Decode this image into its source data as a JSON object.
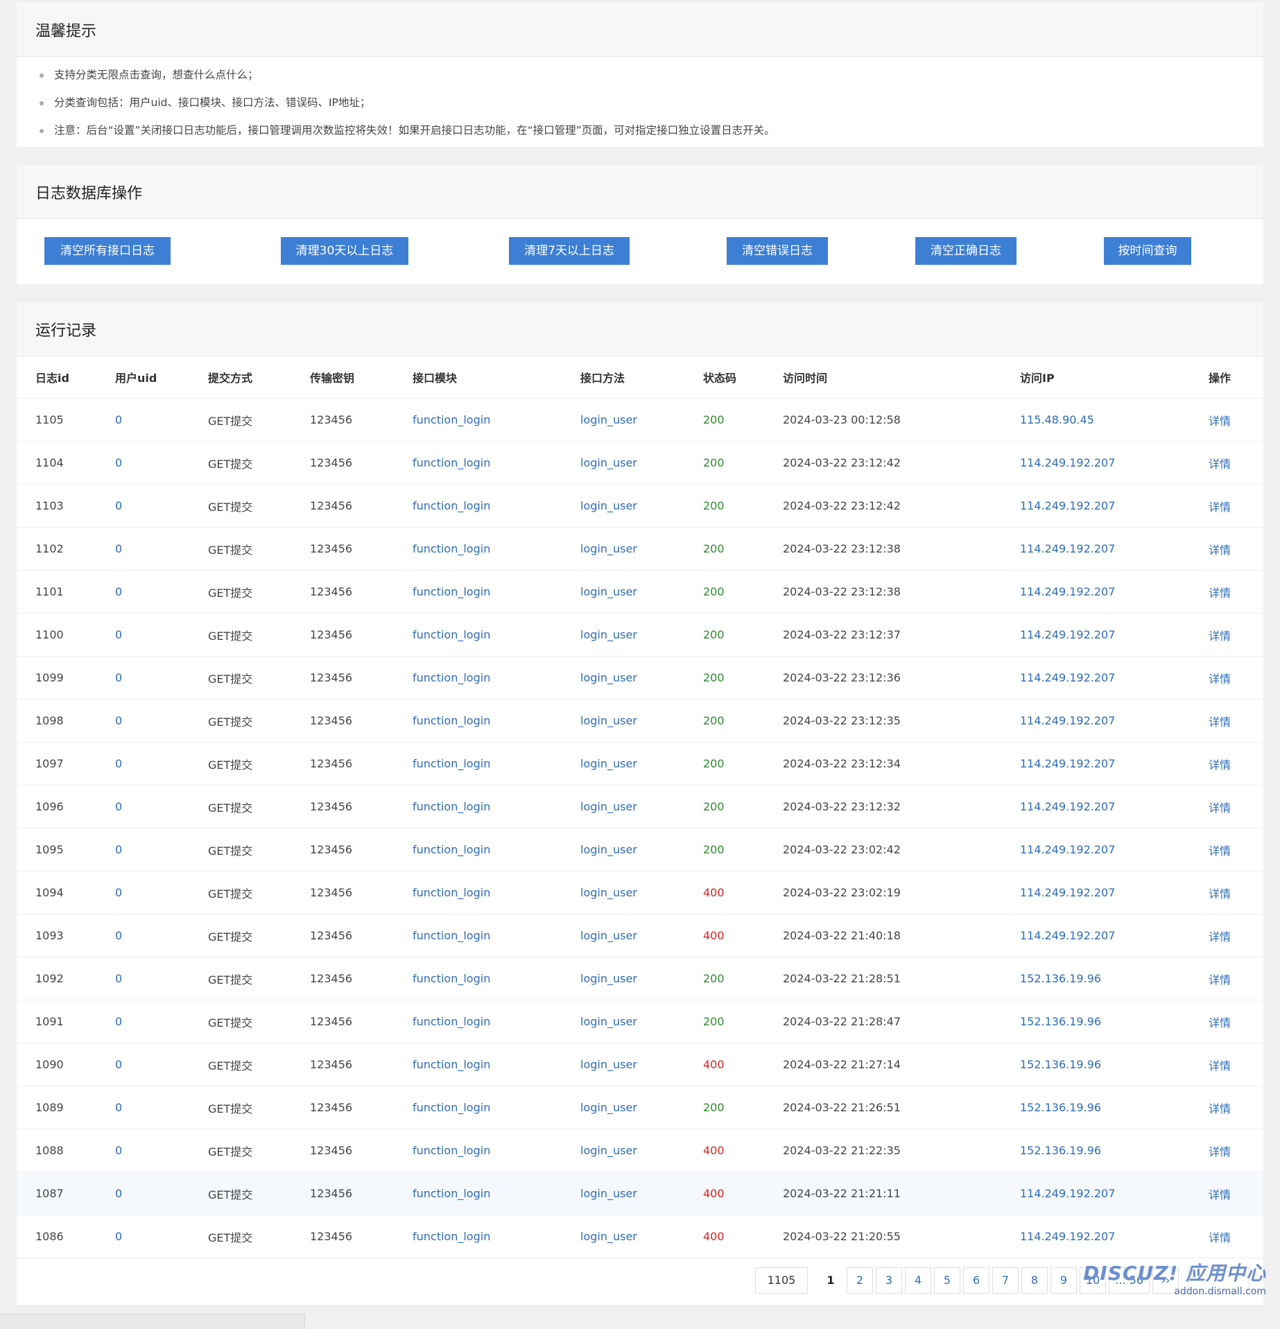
{
  "tips": {
    "title": "温馨提示",
    "items": [
      "支持分类无限点击查询，想查什么点什么；",
      "分类查询包括：用户uid、接口模块、接口方法、错误码、IP地址；",
      "注意：后台“设置”关闭接口日志功能后，接口管理调用次数监控将失效！如果开启接口日志功能，在“接口管理”页面，可对指定接口独立设置日志开关。"
    ]
  },
  "db_ops": {
    "title": "日志数据库操作",
    "buttons": [
      "清空所有接口日志",
      "清理30天以上日志",
      "清理7天以上日志",
      "清空错误日志",
      "清空正确日志",
      "按时间查询"
    ]
  },
  "records": {
    "title": "运行记录",
    "columns": [
      "日志id",
      "用户uid",
      "提交方式",
      "传输密钥",
      "接口模块",
      "接口方法",
      "状态码",
      "访问时间",
      "访问IP",
      "操作"
    ],
    "rows": [
      {
        "id": "1105",
        "uid": "0",
        "method": "GET提交",
        "key": "123456",
        "module": "function_login",
        "action": "login_user",
        "code": "200",
        "time": "2024-03-23 00:12:58",
        "ip": "115.48.90.45",
        "op": "详情"
      },
      {
        "id": "1104",
        "uid": "0",
        "method": "GET提交",
        "key": "123456",
        "module": "function_login",
        "action": "login_user",
        "code": "200",
        "time": "2024-03-22 23:12:42",
        "ip": "114.249.192.207",
        "op": "详情"
      },
      {
        "id": "1103",
        "uid": "0",
        "method": "GET提交",
        "key": "123456",
        "module": "function_login",
        "action": "login_user",
        "code": "200",
        "time": "2024-03-22 23:12:42",
        "ip": "114.249.192.207",
        "op": "详情"
      },
      {
        "id": "1102",
        "uid": "0",
        "method": "GET提交",
        "key": "123456",
        "module": "function_login",
        "action": "login_user",
        "code": "200",
        "time": "2024-03-22 23:12:38",
        "ip": "114.249.192.207",
        "op": "详情"
      },
      {
        "id": "1101",
        "uid": "0",
        "method": "GET提交",
        "key": "123456",
        "module": "function_login",
        "action": "login_user",
        "code": "200",
        "time": "2024-03-22 23:12:38",
        "ip": "114.249.192.207",
        "op": "详情"
      },
      {
        "id": "1100",
        "uid": "0",
        "method": "GET提交",
        "key": "123456",
        "module": "function_login",
        "action": "login_user",
        "code": "200",
        "time": "2024-03-22 23:12:37",
        "ip": "114.249.192.207",
        "op": "详情"
      },
      {
        "id": "1099",
        "uid": "0",
        "method": "GET提交",
        "key": "123456",
        "module": "function_login",
        "action": "login_user",
        "code": "200",
        "time": "2024-03-22 23:12:36",
        "ip": "114.249.192.207",
        "op": "详情"
      },
      {
        "id": "1098",
        "uid": "0",
        "method": "GET提交",
        "key": "123456",
        "module": "function_login",
        "action": "login_user",
        "code": "200",
        "time": "2024-03-22 23:12:35",
        "ip": "114.249.192.207",
        "op": "详情"
      },
      {
        "id": "1097",
        "uid": "0",
        "method": "GET提交",
        "key": "123456",
        "module": "function_login",
        "action": "login_user",
        "code": "200",
        "time": "2024-03-22 23:12:34",
        "ip": "114.249.192.207",
        "op": "详情"
      },
      {
        "id": "1096",
        "uid": "0",
        "method": "GET提交",
        "key": "123456",
        "module": "function_login",
        "action": "login_user",
        "code": "200",
        "time": "2024-03-22 23:12:32",
        "ip": "114.249.192.207",
        "op": "详情"
      },
      {
        "id": "1095",
        "uid": "0",
        "method": "GET提交",
        "key": "123456",
        "module": "function_login",
        "action": "login_user",
        "code": "200",
        "time": "2024-03-22 23:02:42",
        "ip": "114.249.192.207",
        "op": "详情"
      },
      {
        "id": "1094",
        "uid": "0",
        "method": "GET提交",
        "key": "123456",
        "module": "function_login",
        "action": "login_user",
        "code": "400",
        "time": "2024-03-22 23:02:19",
        "ip": "114.249.192.207",
        "op": "详情"
      },
      {
        "id": "1093",
        "uid": "0",
        "method": "GET提交",
        "key": "123456",
        "module": "function_login",
        "action": "login_user",
        "code": "400",
        "time": "2024-03-22 21:40:18",
        "ip": "114.249.192.207",
        "op": "详情"
      },
      {
        "id": "1092",
        "uid": "0",
        "method": "GET提交",
        "key": "123456",
        "module": "function_login",
        "action": "login_user",
        "code": "200",
        "time": "2024-03-22 21:28:51",
        "ip": "152.136.19.96",
        "op": "详情"
      },
      {
        "id": "1091",
        "uid": "0",
        "method": "GET提交",
        "key": "123456",
        "module": "function_login",
        "action": "login_user",
        "code": "200",
        "time": "2024-03-22 21:28:47",
        "ip": "152.136.19.96",
        "op": "详情"
      },
      {
        "id": "1090",
        "uid": "0",
        "method": "GET提交",
        "key": "123456",
        "module": "function_login",
        "action": "login_user",
        "code": "400",
        "time": "2024-03-22 21:27:14",
        "ip": "152.136.19.96",
        "op": "详情"
      },
      {
        "id": "1089",
        "uid": "0",
        "method": "GET提交",
        "key": "123456",
        "module": "function_login",
        "action": "login_user",
        "code": "200",
        "time": "2024-03-22 21:26:51",
        "ip": "152.136.19.96",
        "op": "详情"
      },
      {
        "id": "1088",
        "uid": "0",
        "method": "GET提交",
        "key": "123456",
        "module": "function_login",
        "action": "login_user",
        "code": "400",
        "time": "2024-03-22 21:22:35",
        "ip": "152.136.19.96",
        "op": "详情"
      },
      {
        "id": "1087",
        "uid": "0",
        "method": "GET提交",
        "key": "123456",
        "module": "function_login",
        "action": "login_user",
        "code": "400",
        "time": "2024-03-22 21:21:11",
        "ip": "114.249.192.207",
        "op": "详情"
      },
      {
        "id": "1086",
        "uid": "0",
        "method": "GET提交",
        "key": "123456",
        "module": "function_login",
        "action": "login_user",
        "code": "400",
        "time": "2024-03-22 21:20:55",
        "ip": "114.249.192.207",
        "op": "详情"
      }
    ]
  },
  "pagination": {
    "total": "1105",
    "current": "1",
    "pages": [
      "2",
      "3",
      "4",
      "5",
      "6",
      "7",
      "8",
      "9",
      "10"
    ],
    "last": "... 56",
    "next": "››"
  },
  "watermark": {
    "logo": "DISCUZ! 应用中心",
    "url": "addon.dismall.com"
  },
  "statusbar": {
    "text": ""
  },
  "colors": {
    "button_bg": "#3d7fd4",
    "link": "#2e6cb8",
    "status_ok": "#2e8b2e",
    "status_error": "#e02020"
  }
}
